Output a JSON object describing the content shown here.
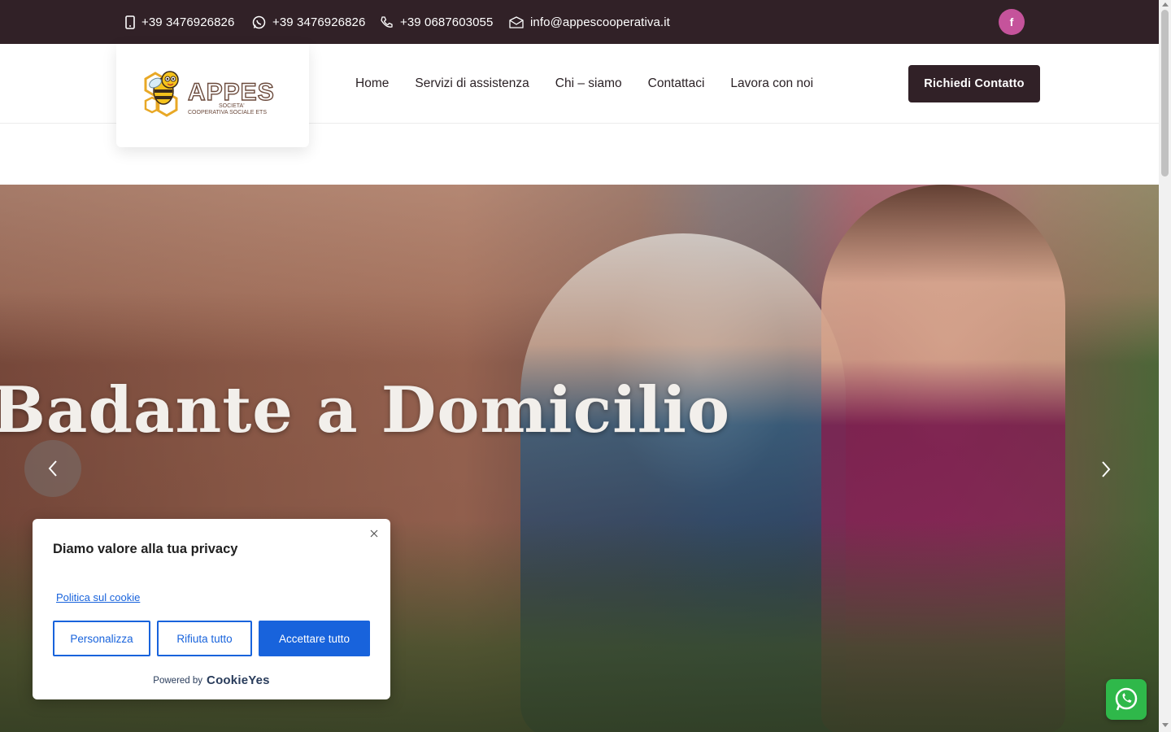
{
  "topbar": {
    "mobile": "+39 3476926826",
    "whatsapp": "+39 3476926826",
    "phone": "+39 0687603055",
    "email": "info@appescooperativa.it",
    "social": "f"
  },
  "logo": {
    "name": "APPES",
    "line1": "SOCIETA'",
    "line2": "COOPERATIVA SOCIALE ETS"
  },
  "nav": {
    "items": [
      "Home",
      "Servizi di assistenza",
      "Chi – siamo",
      "Contattaci",
      "Lavora con noi"
    ]
  },
  "cta": {
    "label": "Richiedi Contatto"
  },
  "hero": {
    "title": "Badante a Domicilio"
  },
  "cookie": {
    "title": "Diamo valore alla tua privacy",
    "policy_link": "Politica sul cookie",
    "customize": "Personalizza",
    "reject": "Rifiuta tutto",
    "accept": "Accettare tutto",
    "powered_by": "Powered by",
    "brand": "CookieYes"
  },
  "colors": {
    "topbar": "#312127",
    "accent_blue": "#1863dc",
    "facebook": "#c5539b",
    "whatsapp": "#2fb84a"
  }
}
